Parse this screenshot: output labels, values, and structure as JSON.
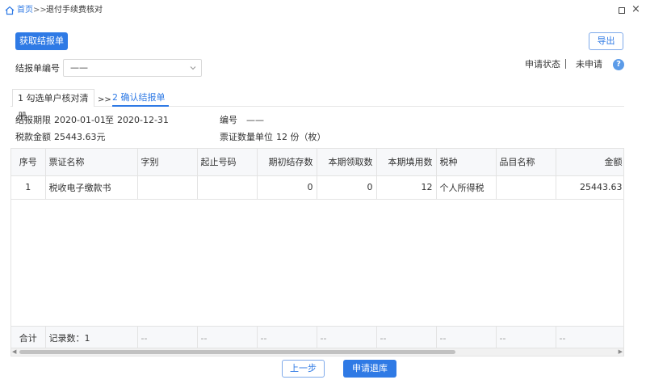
{
  "breadcrumb": {
    "home": "首页",
    "separator": ">>",
    "current": "退付手续费核对"
  },
  "window": {
    "close_glyph": "×"
  },
  "toolbar": {
    "fetch_label": "获取结报单",
    "export_label": "导出"
  },
  "filter": {
    "report_no_label": "结报单编号",
    "report_no_value": "——"
  },
  "status": {
    "label": "申请状态",
    "value": "未申请",
    "help_glyph": "?"
  },
  "steps": [
    {
      "label": "1 勾选单户核对清册",
      "active": false
    },
    {
      "label": "2 确认结报单",
      "active": true
    }
  ],
  "steps_separator": ">>",
  "info": {
    "period_label": "结报期限",
    "period_start": "2020-01-01",
    "period_to": "至",
    "period_end": "2020-12-31",
    "number_label": "编号",
    "number_value": "——",
    "amount_label": "税款金额",
    "amount_value": "25443.63元",
    "unit_label": "票证数量单位",
    "unit_value": "12 份（枚）"
  },
  "table": {
    "columns": [
      "序号",
      "票证名称",
      "字别",
      "起止号码",
      "期初结存数",
      "本期领取数",
      "本期填用数",
      "税种",
      "品目名称",
      "金额"
    ],
    "rows": [
      [
        "1",
        "税收电子缴款书",
        "",
        "",
        "0",
        "0",
        "12",
        "个人所得税",
        "",
        "25443.63"
      ]
    ],
    "footer": {
      "total_label": "合计",
      "records_label": "记录数：1",
      "dash": "--"
    }
  },
  "actions": {
    "prev_label": "上一步",
    "apply_label": "申请退库"
  },
  "colors": {
    "accent": "#2f7ae5",
    "help": "#5b9be8"
  }
}
